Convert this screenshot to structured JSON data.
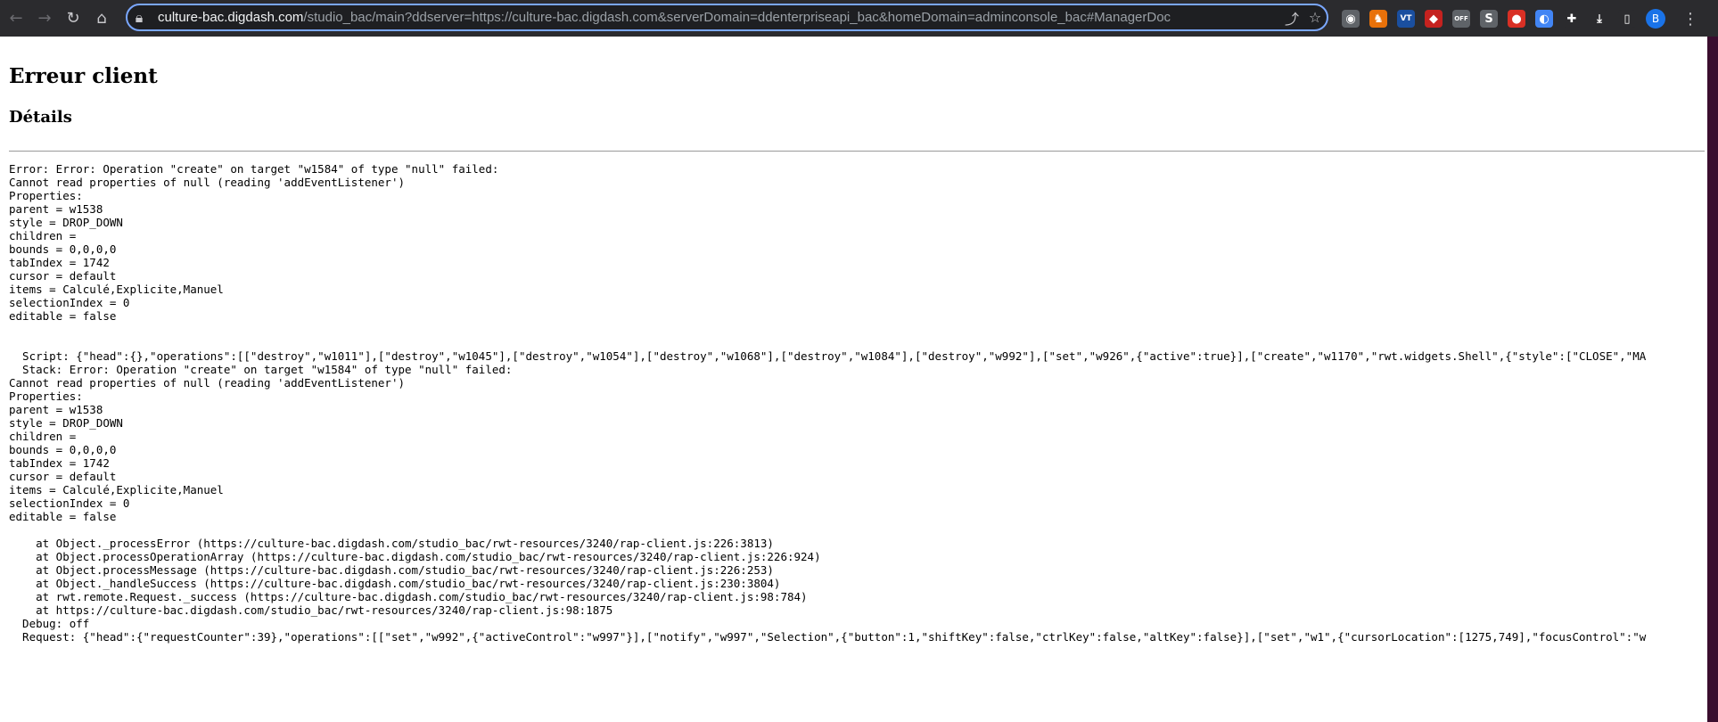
{
  "browser": {
    "url_host": "culture-bac.digdash.com",
    "url_path": "/studio_bac/main?ddserver=https://culture-bac.digdash.com&serverDomain=ddenterpriseapi_bac&homeDomain=adminconsole_bac#ManagerDoc",
    "icons": {
      "back": "back-arrow-icon",
      "forward": "forward-arrow-icon",
      "reload": "reload-icon",
      "home": "home-icon",
      "lock": "lock-icon",
      "share": "share-icon",
      "star": "bookmark-star-icon"
    },
    "extensions": [
      {
        "name": "camera-extension-icon",
        "glyph": "◉",
        "color": "#5f6368"
      },
      {
        "name": "fox-extension-icon",
        "glyph": "♞",
        "color": "#e8710a"
      },
      {
        "name": "vt-extension-icon",
        "glyph": "VT",
        "color": "#1a4fa0"
      },
      {
        "name": "shield-extension-icon",
        "glyph": "◆",
        "color": "#c5221f"
      },
      {
        "name": "off-extension-icon",
        "glyph": "OFF",
        "color": "#5f6368"
      },
      {
        "name": "s-extension-icon",
        "glyph": "S",
        "color": "#5f6368"
      },
      {
        "name": "red-extension-icon",
        "glyph": "●",
        "color": "#d93025"
      },
      {
        "name": "globe-extension-icon",
        "glyph": "◐",
        "color": "#4285f4"
      },
      {
        "name": "puzzle-extension-icon",
        "glyph": "✚",
        "color": "#2b2b2e"
      },
      {
        "name": "download-icon",
        "glyph": "⤓",
        "color": "#2b2b2e"
      },
      {
        "name": "sidebar-icon",
        "glyph": "▯",
        "color": "#2b2b2e"
      }
    ],
    "profile_initial": "B",
    "menu_glyph": "⋮"
  },
  "page": {
    "title": "Erreur client",
    "subtitle": "Détails",
    "details_text": "Error: Error: Operation \"create\" on target \"w1584\" of type \"null\" failed:\nCannot read properties of null (reading 'addEventListener')\nProperties:\nparent = w1538\nstyle = DROP_DOWN\nchildren =\nbounds = 0,0,0,0\ntabIndex = 1742\ncursor = default\nitems = Calculé,Explicite,Manuel\nselectionIndex = 0\neditable = false\n\n\n  Script: {\"head\":{},\"operations\":[[\"destroy\",\"w1011\"],[\"destroy\",\"w1045\"],[\"destroy\",\"w1054\"],[\"destroy\",\"w1068\"],[\"destroy\",\"w1084\"],[\"destroy\",\"w992\"],[\"set\",\"w926\",{\"active\":true}],[\"create\",\"w1170\",\"rwt.widgets.Shell\",{\"style\":[\"CLOSE\",\"MA\n  Stack: Error: Operation \"create\" on target \"w1584\" of type \"null\" failed:\nCannot read properties of null (reading 'addEventListener')\nProperties:\nparent = w1538\nstyle = DROP_DOWN\nchildren =\nbounds = 0,0,0,0\ntabIndex = 1742\ncursor = default\nitems = Calculé,Explicite,Manuel\nselectionIndex = 0\neditable = false\n\n    at Object._processError (https://culture-bac.digdash.com/studio_bac/rwt-resources/3240/rap-client.js:226:3813)\n    at Object.processOperationArray (https://culture-bac.digdash.com/studio_bac/rwt-resources/3240/rap-client.js:226:924)\n    at Object.processMessage (https://culture-bac.digdash.com/studio_bac/rwt-resources/3240/rap-client.js:226:253)\n    at Object._handleSuccess (https://culture-bac.digdash.com/studio_bac/rwt-resources/3240/rap-client.js:230:3804)\n    at rwt.remote.Request._success (https://culture-bac.digdash.com/studio_bac/rwt-resources/3240/rap-client.js:98:784)\n    at https://culture-bac.digdash.com/studio_bac/rwt-resources/3240/rap-client.js:98:1875\n  Debug: off\n  Request: {\"head\":{\"requestCounter\":39},\"operations\":[[\"set\",\"w992\",{\"activeControl\":\"w997\"}],[\"notify\",\"w997\",\"Selection\",{\"button\":1,\"shiftKey\":false,\"ctrlKey\":false,\"altKey\":false}],[\"set\",\"w1\",{\"cursorLocation\":[1275,749],\"focusControl\":\"w"
  }
}
